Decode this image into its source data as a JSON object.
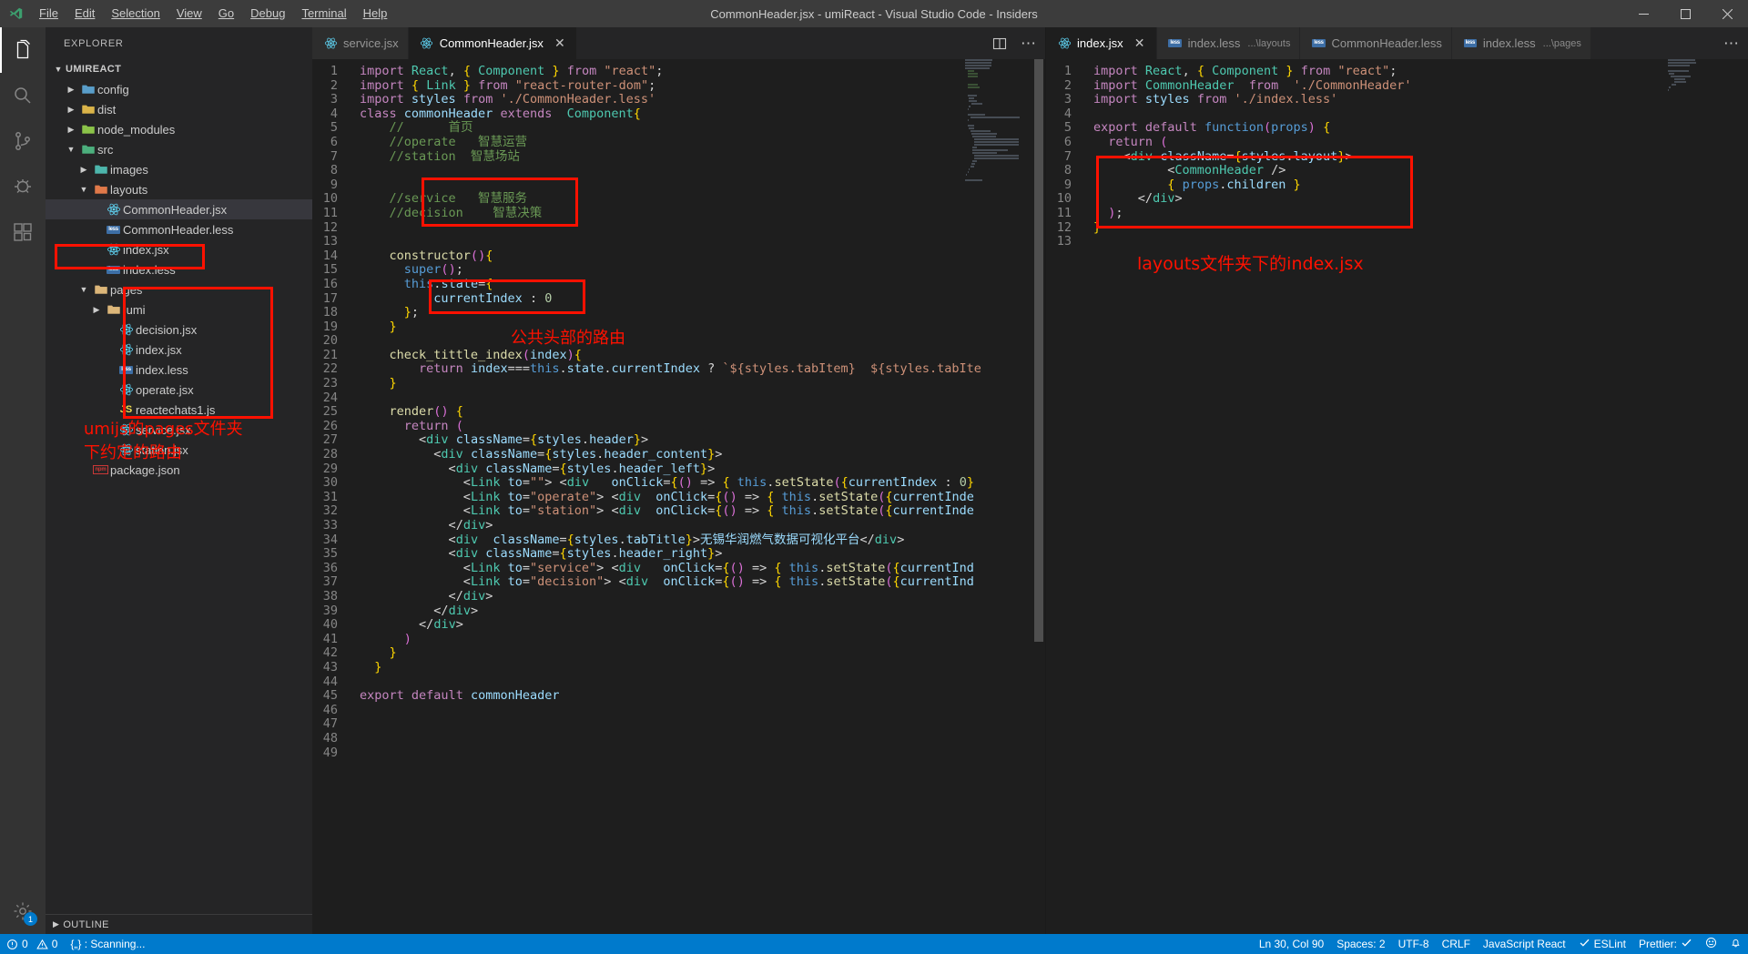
{
  "titlebar": {
    "window_title": "CommonHeader.jsx - umiReact - Visual Studio Code - Insiders",
    "logo_name": "vscode-logo",
    "menus": [
      {
        "label": "File"
      },
      {
        "label": "Edit"
      },
      {
        "label": "Selection"
      },
      {
        "label": "View"
      },
      {
        "label": "Go"
      },
      {
        "label": "Debug"
      },
      {
        "label": "Terminal"
      },
      {
        "label": "Help"
      }
    ],
    "controls": [
      "minimize",
      "maximize",
      "close"
    ]
  },
  "activitybar": {
    "items": [
      {
        "name": "explorer",
        "icon": "files-icon",
        "active": true
      },
      {
        "name": "search",
        "icon": "search-icon",
        "active": false
      },
      {
        "name": "source-control",
        "icon": "source-control-icon",
        "active": false
      },
      {
        "name": "debug",
        "icon": "debug-icon",
        "active": false
      },
      {
        "name": "extensions",
        "icon": "extensions-icon",
        "active": false
      }
    ],
    "bottom": [
      {
        "name": "settings",
        "icon": "gear-icon",
        "badge": "1"
      }
    ]
  },
  "sidebar": {
    "header": "EXPLORER",
    "root": "UMIREACT",
    "tree": [
      {
        "label": "config",
        "indent": 1,
        "twisty": "collapsed",
        "icon": "folder-config",
        "selected": false
      },
      {
        "label": "dist",
        "indent": 1,
        "twisty": "collapsed",
        "icon": "folder-dist",
        "selected": false
      },
      {
        "label": "node_modules",
        "indent": 1,
        "twisty": "collapsed",
        "icon": "folder-node",
        "selected": false
      },
      {
        "label": "src",
        "indent": 1,
        "twisty": "expanded",
        "icon": "folder-src",
        "selected": false
      },
      {
        "label": "images",
        "indent": 2,
        "twisty": "collapsed",
        "icon": "folder-images",
        "selected": false
      },
      {
        "label": "layouts",
        "indent": 2,
        "twisty": "expanded",
        "icon": "folder-layouts",
        "selected": false
      },
      {
        "label": "CommonHeader.jsx",
        "indent": 3,
        "twisty": "none",
        "icon": "react-icon",
        "selected": true
      },
      {
        "label": "CommonHeader.less",
        "indent": 3,
        "twisty": "none",
        "icon": "less-icon",
        "selected": false
      },
      {
        "label": "index.jsx",
        "indent": 3,
        "twisty": "none",
        "icon": "react-icon",
        "selected": false
      },
      {
        "label": "index.less",
        "indent": 3,
        "twisty": "none",
        "icon": "less-icon",
        "selected": false
      },
      {
        "label": "pages",
        "indent": 2,
        "twisty": "expanded",
        "icon": "folder-generic",
        "selected": false
      },
      {
        "label": ".umi",
        "indent": 3,
        "twisty": "collapsed",
        "icon": "folder-generic",
        "selected": false
      },
      {
        "label": "decision.jsx",
        "indent": 4,
        "twisty": "none",
        "icon": "react-icon",
        "selected": false
      },
      {
        "label": "index.jsx",
        "indent": 4,
        "twisty": "none",
        "icon": "react-icon",
        "selected": false
      },
      {
        "label": "index.less",
        "indent": 4,
        "twisty": "none",
        "icon": "less-icon",
        "selected": false
      },
      {
        "label": "operate.jsx",
        "indent": 4,
        "twisty": "none",
        "icon": "react-icon",
        "selected": false
      },
      {
        "label": "reactechats1.js",
        "indent": 4,
        "twisty": "none",
        "icon": "js-icon",
        "selected": false
      },
      {
        "label": "service.jsx",
        "indent": 4,
        "twisty": "none",
        "icon": "react-icon",
        "selected": false
      },
      {
        "label": "station.jsx",
        "indent": 4,
        "twisty": "none",
        "icon": "react-icon",
        "selected": false
      },
      {
        "label": "package.json",
        "indent": 2,
        "twisty": "none",
        "icon": "npm-icon",
        "selected": false
      }
    ],
    "outline_label": "OUTLINE",
    "annotation": "umijs的pages文件夹\n下约定的路由"
  },
  "annotations": {
    "color": "#ff1100",
    "left_editor_note": "公共头部的路由",
    "right_editor_note": "layouts文件夹下的index.jsx"
  },
  "editor_left": {
    "tabs": [
      {
        "label": "service.jsx",
        "icon": "react-icon",
        "active": false,
        "dirty": false,
        "description": ""
      },
      {
        "label": "CommonHeader.jsx",
        "icon": "react-icon",
        "active": true,
        "dirty": false,
        "description": ""
      }
    ],
    "actions": [
      "split-editor-icon",
      "more-actions-icon"
    ],
    "first_line": 1,
    "lines": [
      "import React, { Component } from \"react\";",
      "import { Link } from \"react-router-dom\";",
      "import styles from './CommonHeader.less'",
      "class commonHeader extends  Component{",
      "    //      首页",
      "    //operate   智慧运营",
      "    //station  智慧场站",
      "",
      "",
      "    //service   智慧服务",
      "    //decision    智慧决策",
      "",
      "",
      "    constructor(){",
      "      super();",
      "      this.state={",
      "          currentIndex : 0",
      "      };",
      "    }",
      "",
      "    check_tittle_index(index){",
      "        return index===this.state.currentIndex ? `${styles.tabItem}  ${styles.tabIte",
      "    }",
      "",
      "    render() {",
      "      return (",
      "        <div className={styles.header}>",
      "          <div className={styles.header_content}>",
      "            <div className={styles.header_left}>",
      "              <Link to=\"\"> <div   onClick={() => { this.setState({currentIndex : 0}",
      "              <Link to=\"operate\"> <div  onClick={() => { this.setState({currentInde",
      "              <Link to=\"station\"> <div  onClick={() => { this.setState({currentInde",
      "            </div>",
      "            <div  className={styles.tabTitle}>无锡华润燃气数据可视化平台</div>",
      "            <div className={styles.header_right}>",
      "              <Link to=\"service\"> <div   onClick={() => { this.setState({currentInd",
      "              <Link to=\"decision\"> <div  onClick={() => { this.setState({currentInd",
      "            </div>",
      "          </div>",
      "        </div>",
      "      )",
      "    }",
      "  }",
      "",
      "export default commonHeader",
      "",
      "",
      "",
      ""
    ]
  },
  "editor_right": {
    "tabs": [
      {
        "label": "index.jsx",
        "icon": "react-icon",
        "active": true,
        "dirty": false,
        "description": ""
      },
      {
        "label": "index.less",
        "icon": "less-icon",
        "active": false,
        "dirty": false,
        "description": "...\\layouts"
      },
      {
        "label": "CommonHeader.less",
        "icon": "less-icon",
        "active": false,
        "dirty": false,
        "description": ""
      },
      {
        "label": "index.less",
        "icon": "less-icon",
        "active": false,
        "dirty": false,
        "description": "...\\pages"
      }
    ],
    "actions": [
      "more-actions-icon"
    ],
    "first_line": 1,
    "lines": [
      "import React, { Component } from \"react\";",
      "import CommonHeader  from  './CommonHeader'",
      "import styles from './index.less'",
      "",
      "export default function(props) {",
      "  return (",
      "    <div className={styles.layout}>",
      "          <CommonHeader />",
      "          { props.children }",
      "      </div>",
      "  );",
      "}",
      ""
    ]
  },
  "statusbar": {
    "left": [
      {
        "name": "problems",
        "icon": "error-icon",
        "text": "0",
        "icon2": "warning-icon",
        "text2": "0"
      },
      {
        "name": "eslint-scanning",
        "text": "{„} : Scanning..."
      }
    ],
    "right": [
      {
        "name": "cursor-position",
        "text": "Ln 30, Col 90"
      },
      {
        "name": "indentation",
        "text": "Spaces: 2"
      },
      {
        "name": "encoding",
        "text": "UTF-8"
      },
      {
        "name": "eol",
        "text": "CRLF"
      },
      {
        "name": "language-mode",
        "text": "JavaScript React"
      },
      {
        "name": "eslint-status",
        "text": "ESLint",
        "icon": "check-icon"
      },
      {
        "name": "prettier-status",
        "text": "Prettier:",
        "icon": "check-icon"
      },
      {
        "name": "feedback",
        "icon": "smiley-icon",
        "text": ""
      },
      {
        "name": "notifications",
        "icon": "bell-icon",
        "text": ""
      }
    ]
  }
}
